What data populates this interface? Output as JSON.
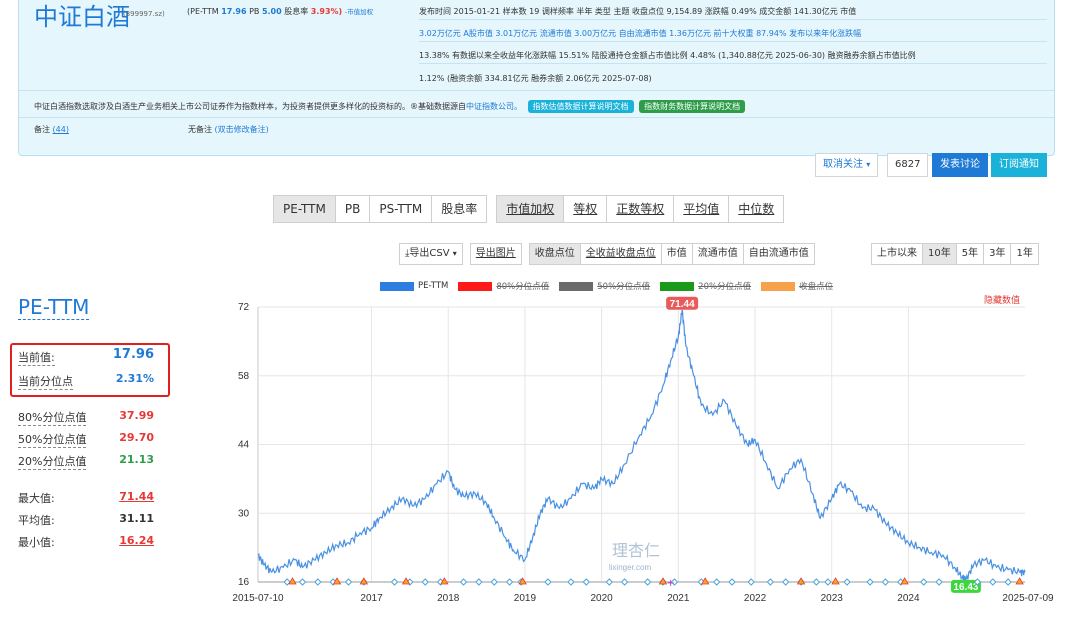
{
  "header": {
    "title": "中证白酒",
    "code": "(399997.sz)",
    "pe_label": "(PE-TTM",
    "pe_value": "17.96",
    "pb_label": "PB",
    "pb_value": "5.00",
    "dy_label": "股息率",
    "dy_value": "3.93%)",
    "dy_note": "-市值加权",
    "row1": "发布时间 2015-01-21   样本数 19   调样频率 半年   类型 主题   收盘点位 9,154.89   涨跌幅 0.49%   成交金额 141.30亿元   市值",
    "row2": "3.02万亿元   A股市值 3.01万亿元   流通市值 3.00万亿元   自由流通市值 1.36万亿元   前十大权重 87.94%   发布以来年化涨跌幅",
    "row3": "13.38%   有数据以来全收益年化涨跌幅 15.51%   陆股通持仓金额占市值比例 4.48% (1,340.88亿元  2025-06-30)   融资融券余额占市值比例",
    "row4": "1.12% (融资余额 334.81亿元  融券余额 2.06亿元  2025-07-08)",
    "desc": "中证白酒指数选取涉及白酒生产业务相关上市公司证券作为指数样本，为投资者提供更多样化的投资标的。®基础数据源自",
    "desc_link": "中证指数公司。",
    "badge1": "指数估值数据计算说明文档",
    "badge2": "指数财务数据计算说明文档",
    "note_label": "备注",
    "note_count": "(44)",
    "no_note": "无备注",
    "no_note_link": "(双击修改备注)"
  },
  "actions": {
    "unfollow": "取消关注",
    "follow_count": "6827",
    "discuss": "发表讨论",
    "subscribe": "订阅通知"
  },
  "tabs": [
    "PE-TTM",
    "PB",
    "PS-TTM",
    "股息率",
    "市值加权",
    "等权",
    "正数等权",
    "平均值",
    "中位数"
  ],
  "subtabs": {
    "export_csv": "导出CSV",
    "export_img": "导出图片",
    "price_modes": [
      "收盘点位",
      "全收益收盘点位",
      "市值",
      "流通市值",
      "自由流通市值"
    ],
    "ranges": [
      "上市以来",
      "10年",
      "5年",
      "3年",
      "1年"
    ]
  },
  "side": {
    "title": "PE-TTM",
    "current_label": "当前值:",
    "current": "17.96",
    "pct_label": "当前分位点",
    "pct": "2.31%",
    "p80_label": "80%分位点值",
    "p80": "37.99",
    "p50_label": "50%分位点值",
    "p50": "29.70",
    "p20_label": "20%分位点值",
    "p20": "21.13",
    "max_label": "最大值:",
    "max": "71.44",
    "avg_label": "平均值:",
    "avg": "31.11",
    "min_label": "最小值:",
    "min": "16.24"
  },
  "legend": [
    "PE-TTM",
    "80%分位点值",
    "50%分位点值",
    "20%分位点值",
    "收盘点位"
  ],
  "colors": {
    "line": "#4a90e2",
    "accent": "#1f7ad6",
    "red": "#e53935",
    "green": "#2e9d4a"
  },
  "hide_values": "隐藏数值",
  "watermark": "理杏仁",
  "watermark_sub": "lixinger.com",
  "chart_data": {
    "type": "line",
    "title": "",
    "xlabel": "",
    "ylabel": "",
    "ylim": [
      16,
      72
    ],
    "yticks": [
      16,
      30,
      44,
      58,
      72
    ],
    "xticks": [
      "2015-07-10",
      "2017",
      "2018",
      "2019",
      "2020",
      "2021",
      "2022",
      "2023",
      "2024",
      "2025-07-09"
    ],
    "max_label": "71.44",
    "min_label": "16.43",
    "series": [
      {
        "name": "PE-TTM",
        "x": [
          2015.52,
          2015.6,
          2015.7,
          2015.85,
          2016.0,
          2016.1,
          2016.25,
          2016.4,
          2016.55,
          2016.7,
          2016.85,
          2017.0,
          2017.1,
          2017.25,
          2017.4,
          2017.55,
          2017.7,
          2017.85,
          2018.0,
          2018.08,
          2018.2,
          2018.35,
          2018.5,
          2018.6,
          2018.75,
          2018.85,
          2019.0,
          2019.1,
          2019.2,
          2019.3,
          2019.45,
          2019.6,
          2019.75,
          2019.9,
          2020.0,
          2020.15,
          2020.3,
          2020.5,
          2020.65,
          2020.8,
          2020.9,
          2021.0,
          2021.05,
          2021.1,
          2021.2,
          2021.3,
          2021.45,
          2021.6,
          2021.75,
          2021.9,
          2022.0,
          2022.15,
          2022.3,
          2022.45,
          2022.6,
          2022.75,
          2022.85,
          2023.0,
          2023.1,
          2023.25,
          2023.4,
          2023.55,
          2023.7,
          2023.85,
          2024.0,
          2024.15,
          2024.3,
          2024.45,
          2024.6,
          2024.7,
          2024.75,
          2024.85,
          2025.0,
          2025.15,
          2025.3,
          2025.45,
          2025.52
        ],
        "values": [
          21.5,
          19.5,
          18.0,
          19.0,
          20.5,
          19.0,
          20.5,
          22.0,
          23.5,
          24.0,
          26.0,
          27.0,
          29.0,
          31.0,
          33.0,
          31.5,
          33.0,
          36.0,
          38.5,
          35.0,
          33.5,
          34.0,
          32.0,
          29.0,
          25.0,
          22.5,
          20.5,
          25.0,
          30.0,
          33.0,
          31.0,
          33.0,
          36.0,
          35.0,
          37.0,
          36.0,
          40.0,
          46.0,
          50.0,
          56.0,
          61.0,
          66.0,
          71.44,
          64.0,
          58.0,
          52.0,
          50.0,
          53.0,
          48.0,
          44.0,
          45.0,
          40.0,
          35.0,
          39.0,
          41.0,
          34.0,
          29.0,
          33.0,
          36.0,
          34.5,
          31.0,
          31.0,
          28.0,
          26.0,
          24.0,
          23.0,
          22.0,
          21.5,
          19.0,
          17.0,
          16.43,
          19.5,
          20.5,
          19.0,
          18.5,
          18.0,
          17.96
        ]
      }
    ]
  }
}
